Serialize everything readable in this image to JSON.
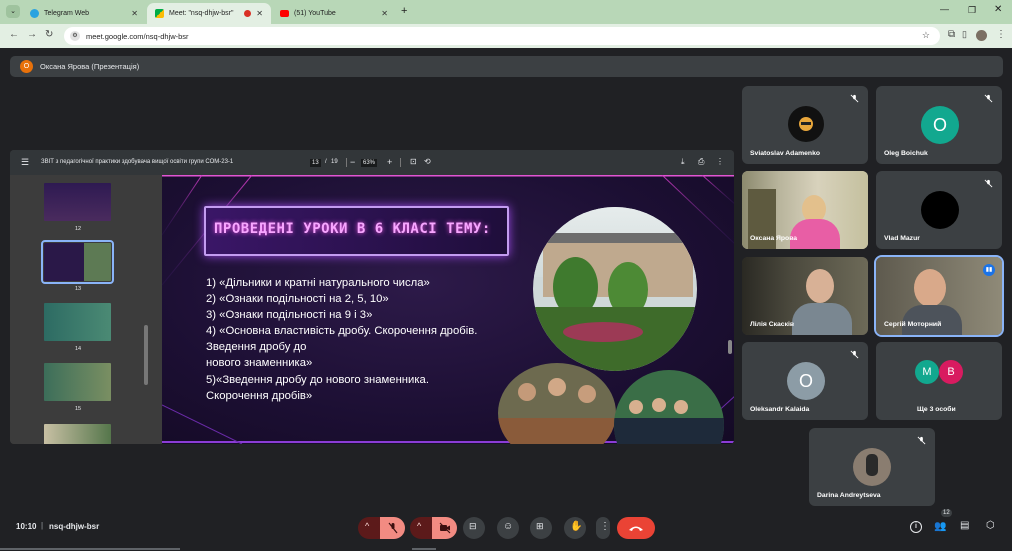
{
  "browser": {
    "tabs": [
      {
        "label": "Telegram Web"
      },
      {
        "label": "Meet: \"nsq-dhjw-bsr\""
      },
      {
        "label": "(51) YouTube"
      }
    ],
    "url": "meet.google.com/nsq-dhjw-bsr"
  },
  "presentation_bar": {
    "avatar_letter": "О",
    "label": "Оксана Ярова (Презентація)"
  },
  "pdf": {
    "title": "ЗВІТ з педагогічної практики здобувача вищої освіти групи СОМ-23-1",
    "page_current": "13",
    "page_sep": "/",
    "page_total": "19",
    "zoom": "63%",
    "thumbnails": [
      "12",
      "13",
      "14",
      "15"
    ],
    "selected_page": "13"
  },
  "slide": {
    "title": "ПРОВЕДЕНІ УРОКИ В 6 КЛАСІ ТЕМУ:",
    "lines": [
      "1) «Дільники и кратні натурального числа»",
      "2) «Ознаки подільності на 2, 5, 10»",
      "3) «Ознаки подільності на 9 і 3»",
      "4) «Основна властивість дробу. Скорочення дробів.",
      "Зведення дробу до",
      "нового знаменника»",
      "5)«Зведення   дробу   до   нового   знаменника.",
      "Скорочення дробів»"
    ]
  },
  "participants": [
    {
      "name": "Sviatoslav Adamenko",
      "muted": true
    },
    {
      "name": "Oleg Boichuk",
      "letter": "O",
      "color": "#12a88f",
      "muted": true
    },
    {
      "name": "Оксана Ярова",
      "muted": false
    },
    {
      "name": "Vlad Mazur",
      "muted": true
    },
    {
      "name": "Лілія Скасків",
      "muted": false
    },
    {
      "name": "Сергій Моторний",
      "muted": false,
      "speaking": true
    },
    {
      "name": "Oleksandr Kalaida",
      "letter": "O",
      "color": "#8c9ca6",
      "muted": true
    },
    {
      "name": "Ще 3 особи",
      "avatars": [
        "M",
        "B"
      ],
      "colors": [
        "#12a88f",
        "#d81b60"
      ]
    },
    {
      "name": "Darina Andreytseva",
      "muted": true
    }
  ],
  "bottom_bar": {
    "time": "10:10",
    "separator": "|",
    "meeting_code": "nsq-dhjw-bsr",
    "participant_count": "12"
  }
}
